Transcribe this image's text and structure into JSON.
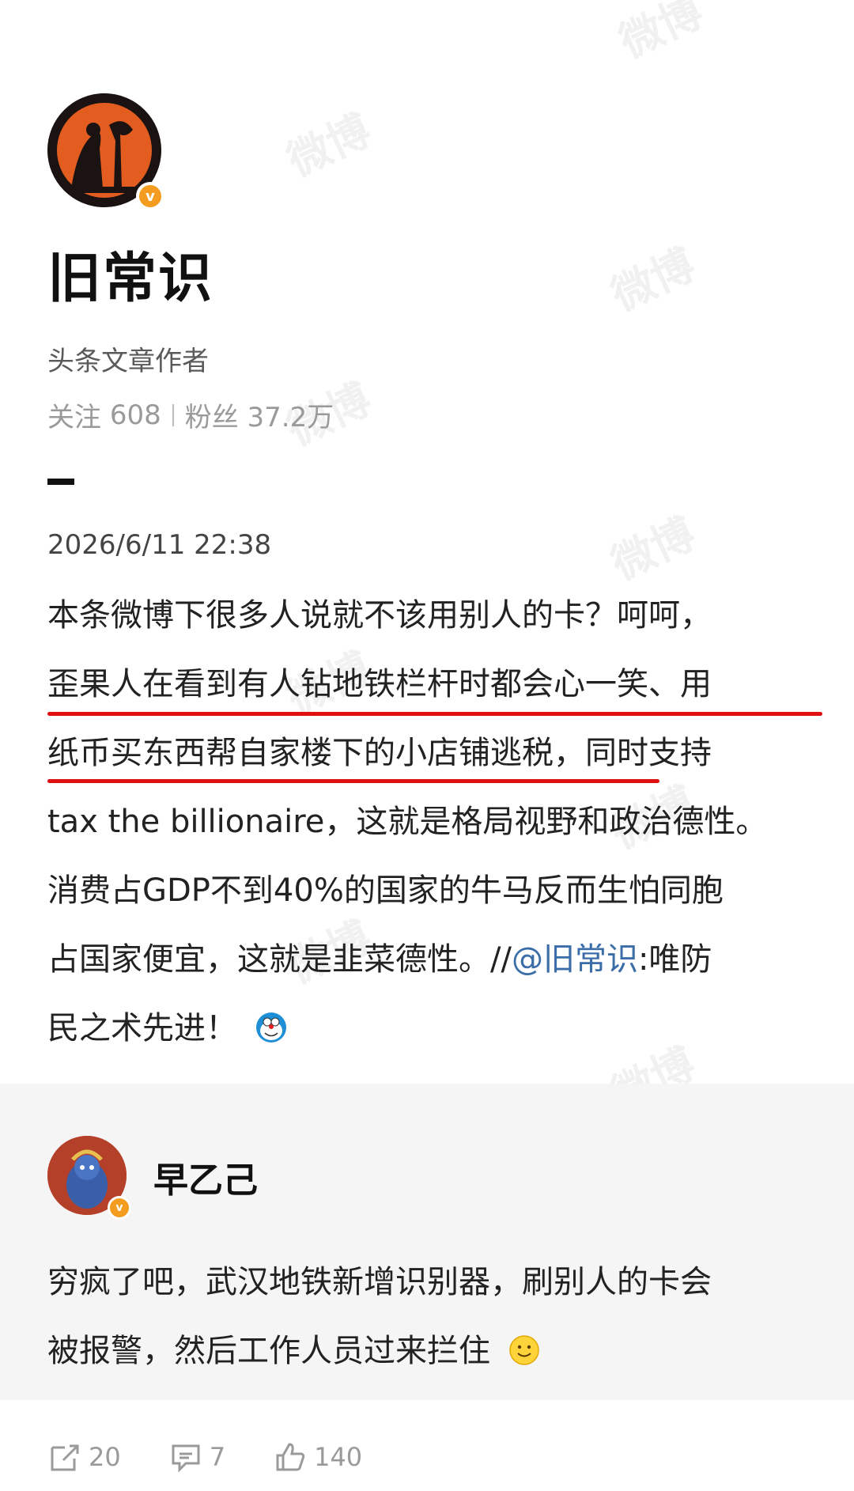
{
  "profile": {
    "name": "旧常识",
    "role": "头条文章作者",
    "following_label": "关注",
    "following_count": "608",
    "followers_label": "粉丝",
    "followers_count": "37.2万",
    "verified": true
  },
  "post": {
    "date": "2026/6/11 22:38",
    "lines": [
      "本条微博下很多人说就不该用别人的卡？呵呵，",
      "歪果人在看到有人钻地铁栏杆时都会心一笑、用",
      "纸币买东西帮自家楼下的小店铺逃税，同时支持",
      "tax the billionaire，这就是格局视野和政治德性。",
      "消费占GDP不到40%的国家的牛马反而生怕同胞"
    ],
    "line6_prefix": "占国家便宜，这就是韭菜德性。//",
    "mention": "@旧常识",
    "line6_suffix": ":唯防",
    "line7": "民之术先进！",
    "highlight_color": "#e01010"
  },
  "comment": {
    "author": "早乙己",
    "verified": true,
    "lines": [
      "穷疯了吧，武汉地铁新增识别器，刷别人的卡会",
      "被报警，然后工作人员过来拦住"
    ]
  },
  "actions": {
    "share_count": "20",
    "comment_count": "7",
    "like_count": "140"
  },
  "watermark_text": "微博"
}
